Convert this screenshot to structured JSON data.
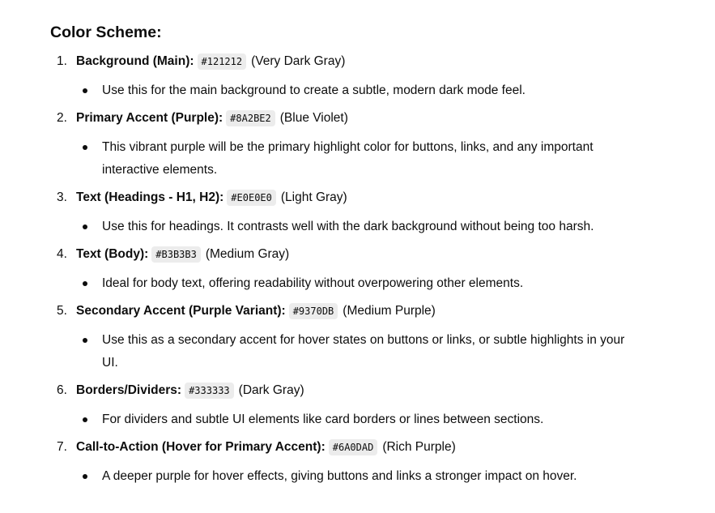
{
  "heading": "Color Scheme:",
  "items": [
    {
      "number": "1.",
      "label": "Background (Main):",
      "code": "#121212",
      "desc": "(Very Dark Gray)",
      "bullet": "Use this for the main background to create a subtle, modern dark mode feel.",
      "color": "#121212"
    },
    {
      "number": "2.",
      "label": "Primary Accent (Purple):",
      "code": "#8A2BE2",
      "desc": "(Blue Violet)",
      "bullet": "This vibrant purple will be the primary highlight color for buttons, links, and any important interactive elements.",
      "color": "#8A2BE2"
    },
    {
      "number": "3.",
      "label": "Text (Headings - H1, H2):",
      "code": "#E0E0E0",
      "desc": "(Light Gray)",
      "bullet": "Use this for headings. It contrasts well with the dark background without being too harsh.",
      "color": "#E0E0E0"
    },
    {
      "number": "4.",
      "label": "Text (Body):",
      "code": "#B3B3B3",
      "desc": "(Medium Gray)",
      "bullet": "Ideal for body text, offering readability without overpowering other elements.",
      "color": "#B3B3B3"
    },
    {
      "number": "5.",
      "label": "Secondary Accent (Purple Variant):",
      "code": "#9370DB",
      "desc": "(Medium Purple)",
      "bullet": "Use this as a secondary accent for hover states on buttons or links, or subtle highlights in your UI.",
      "color": "#9370DB"
    },
    {
      "number": "6.",
      "label": "Borders/Dividers:",
      "code": "#333333",
      "desc": "(Dark Gray)",
      "bullet": "For dividers and subtle UI elements like card borders or lines between sections.",
      "color": "#333333"
    },
    {
      "number": "7.",
      "label": "Call-to-Action (Hover for Primary Accent):",
      "code": "#6A0DAD",
      "desc": "(Rich Purple)",
      "bullet": "A deeper purple for hover effects, giving buttons and links a stronger impact on hover.",
      "color": "#6A0DAD"
    }
  ]
}
